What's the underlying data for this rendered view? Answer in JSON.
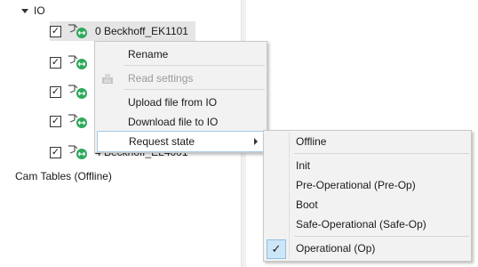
{
  "tree": {
    "root_label": "IO",
    "rows": [
      {
        "label": "0  Beckhoff_EK1101",
        "checked": true,
        "selected": true
      },
      {
        "label": "",
        "checked": true,
        "selected": false
      },
      {
        "label": "",
        "checked": true,
        "selected": false
      },
      {
        "label": "",
        "checked": true,
        "selected": false
      },
      {
        "label": "4  Beckhoff_EL4001",
        "checked": true,
        "selected": false
      }
    ],
    "check_glyph": "✓",
    "cam_tables_label": "Cam Tables (Offline)"
  },
  "context_menu": {
    "items": [
      {
        "label": "Rename",
        "disabled": false
      },
      {
        "label": "Read settings",
        "disabled": true,
        "icon": "read-settings-icon"
      },
      {
        "label": "Upload file from IO",
        "disabled": false
      },
      {
        "label": "Download file to IO",
        "disabled": false
      },
      {
        "label": "Request state",
        "disabled": false,
        "has_submenu": true
      }
    ]
  },
  "submenu": {
    "items": [
      {
        "label": "Offline"
      },
      {
        "label": "Init"
      },
      {
        "label": "Pre-Operational (Pre-Op)"
      },
      {
        "label": "Boot"
      },
      {
        "label": "Safe-Operational (Safe-Op)"
      },
      {
        "label": "Operational (Op)",
        "checked": true
      }
    ],
    "check_glyph": "✓"
  },
  "colors": {
    "link_badge": "#2eaa5c",
    "selected_row": "#e5e5e5",
    "menu_bg": "#f2f2f2",
    "highlight_border": "#a7cbe8",
    "check_highlight": "#cde6f7"
  }
}
